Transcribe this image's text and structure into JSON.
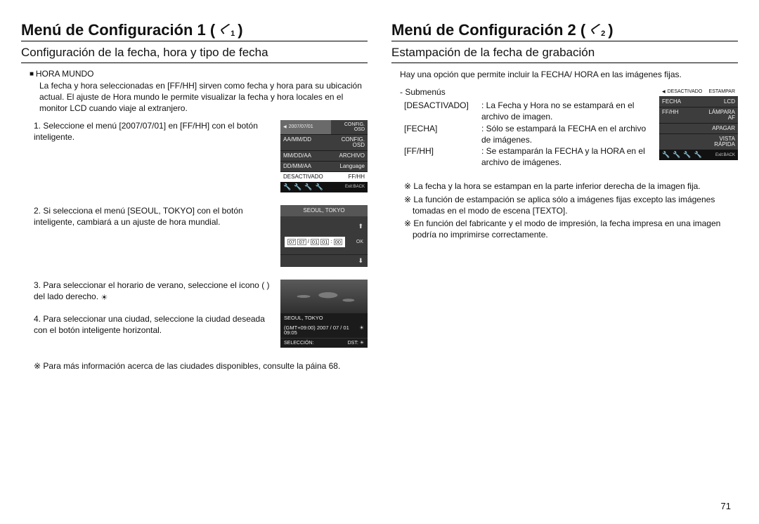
{
  "page_number": "71",
  "left": {
    "title_prefix": "Menú de Configuración 1 (",
    "title_suffix": ")",
    "icon_number": "1",
    "subtitle": "Configuración de la fecha, hora y tipo de fecha",
    "section_label": "HORA MUNDO",
    "intro": "La fecha y hora seleccionadas en [FF/HH] sirven como fecha y hora para su ubicación actual. El ajuste de Hora mundo le permite visualizar la fecha y hora locales en el monitor LCD cuando viaje al extranjero.",
    "steps": [
      "1. Seleccione el menú [2007/07/01] en [FF/HH] con el botón inteligente.",
      "2. Si selecciona el menú [SEOUL, TOKYO] con el botón inteligente, cambiará a un ajuste de hora mundial.",
      "3. Para seleccionar el horario de verano, seleccione el icono (     ) del lado derecho.",
      "4. Para seleccionar una ciudad, seleccione la ciudad deseada con el botón inteligente horizontal."
    ],
    "footnote": "Para más información acerca de las ciudades disponibles, consulte la páina 68.",
    "lcd1": {
      "top_l": "2007/07/01",
      "top_r": "CONFIG. OSD",
      "rows": [
        {
          "l": "AA/MM/DD",
          "r": "CONFIG. OSD"
        },
        {
          "l": "MM/DD/AA",
          "r": "ARCHIVO"
        },
        {
          "l": "DD/MM/AA",
          "r": "Language"
        },
        {
          "l": "DESACTIVADO",
          "r": "FF/HH",
          "active": true
        }
      ],
      "back": "Exit:BACK"
    },
    "lcd2": {
      "title": "SEOUL, TOKYO",
      "date": [
        "07",
        "07",
        "/",
        "01",
        "01",
        ":",
        "00"
      ],
      "ok": "OK"
    },
    "lcd3": {
      "city": "SEOUL, TOKYO",
      "gmt": "(GMT+09:00) 2007 / 07 / 01 09:05",
      "sun": "☀",
      "sel": "SELECCIÓN:",
      "dst": "DST:"
    }
  },
  "right": {
    "title_prefix": "Menú de Configuración 2 (",
    "title_suffix": ")",
    "icon_number": "2",
    "subtitle": "Estampación de la fecha de grabación",
    "lead": "Hay una opción que permite incluir la FECHA/ HORA en las imágenes fijas.",
    "sub_label": "- Submenús",
    "submenus": [
      {
        "k": "[DESACTIVADO]",
        "v": ": La Fecha y Hora no se estampará en el archivo de imagen."
      },
      {
        "k": "[FECHA]",
        "v": ": Sólo se estampará la FECHA en el archivo de imágenes."
      },
      {
        "k": "[FF/HH]",
        "v": ": Se estamparán la FECHA y la HORA en el archivo de imágenes."
      }
    ],
    "notes": [
      "La fecha y la hora se estampan en la parte inferior derecha de la imagen fija.",
      "La función de estampación se aplica sólo a imágenes fijas excepto las imágenes tomadas en el modo de escena [TEXTO].",
      "En función del fabricante y el modo de impresión, la fecha impresa en una imagen podría no imprimirse correctamente."
    ],
    "lcd4": {
      "rows": [
        {
          "l": "DESACTIVADO",
          "r": "ESTAMPAR",
          "active": true
        },
        {
          "l": "FECHA",
          "r": "LCD"
        },
        {
          "l": "FF/HH",
          "r": "LÁMPARA  AF"
        },
        {
          "l": "",
          "r": "APAGAR"
        },
        {
          "l": "",
          "r": "VISTA RÁPIDA"
        }
      ],
      "back": "Exit:BACK"
    }
  }
}
